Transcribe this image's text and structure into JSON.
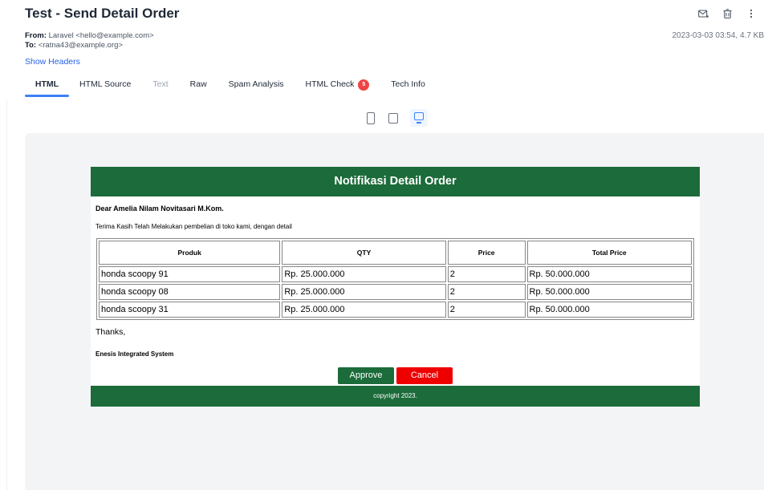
{
  "message": {
    "subject": "Test - Send Detail Order",
    "from_label": "From:",
    "from_value": "Laravel <hello@example.com>",
    "to_label": "To:",
    "to_value": "<ratna43@example.org>",
    "date_size": "2023-03-03 03:54, 4.7 KB",
    "show_headers": "Show Headers"
  },
  "toolbar": {
    "icons": [
      "mail-icon",
      "trash-icon",
      "more-vertical-icon"
    ]
  },
  "tabs": [
    {
      "label": "HTML",
      "active": true
    },
    {
      "label": "HTML Source"
    },
    {
      "label": "Text",
      "disabled": true
    },
    {
      "label": "Raw"
    },
    {
      "label": "Spam Analysis"
    },
    {
      "label": "HTML Check",
      "badge": "5"
    },
    {
      "label": "Tech Info"
    }
  ],
  "viewport": {
    "options": [
      "mobile",
      "tablet",
      "desktop"
    ],
    "selected": "desktop"
  },
  "email": {
    "header_title": "Notifikasi Detail Order",
    "greeting": "Dear Amelia Nilam Novitasari M.Kom.",
    "intro": "Terima Kasih Telah Melakukan pembelian di toko kami, dengan detail",
    "table": {
      "headers": [
        "Produk",
        "QTY",
        "Price",
        "Total Price"
      ],
      "rows": [
        [
          "honda scoopy 91",
          "Rp. 25.000.000",
          "2",
          "Rp. 50.000.000"
        ],
        [
          "honda scoopy 08",
          "Rp. 25.000.000",
          "2",
          "Rp. 50.000.000"
        ],
        [
          "honda scoopy 31",
          "Rp. 25.000.000",
          "2",
          "Rp. 50.000.000"
        ]
      ]
    },
    "thanks": "Thanks,",
    "company": "Enesis Integrated System",
    "approve_label": "Approve",
    "cancel_label": "Cancel",
    "footer": "copyright 2023."
  },
  "colors": {
    "brand_green": "#1c6b3a",
    "cancel_red": "#ef0000",
    "accent_blue": "#3b82f6",
    "badge_red": "#ef4444"
  }
}
